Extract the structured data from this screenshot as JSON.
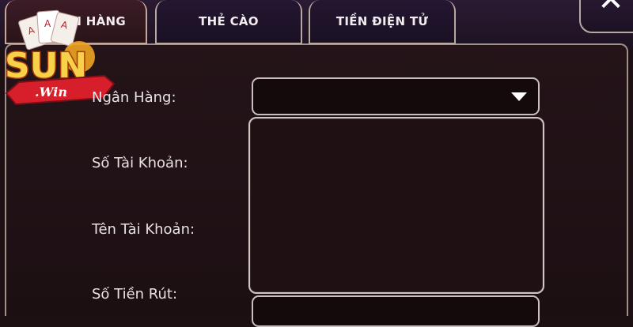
{
  "tabs": [
    {
      "label": "NGÂN HÀNG",
      "active": true
    },
    {
      "label": "THẺ CÀO",
      "active": false
    },
    {
      "label": "TIỀN ĐIỆN TỬ",
      "active": false
    }
  ],
  "logo": {
    "brand": "SUN",
    "sub": ".Win"
  },
  "form": {
    "bank_label": "Ngân Hàng:",
    "account_number_label": "Số Tài Khoản:",
    "account_name_label": "Tên Tài Khoản:",
    "amount_label": "Số Tiền Rút:"
  },
  "icons": {
    "close": "close-icon",
    "dropdown": "triangle-down-icon"
  },
  "colors": {
    "accent": "#e1252f",
    "gold": "#f2c23a",
    "background": "#1d1012"
  }
}
